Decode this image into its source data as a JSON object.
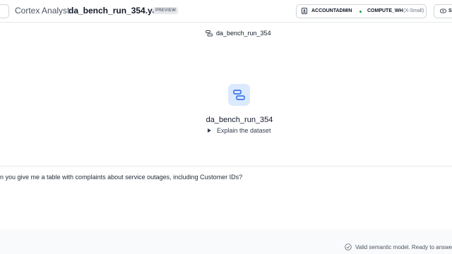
{
  "header": {
    "app_name": "Cortex Analyst",
    "file_name": "da_bench_run_354.yaml",
    "badge": "PREVIEW",
    "role": "ACCOUNTADMIN",
    "warehouse": "COMPUTE_WH",
    "warehouse_size": "(X-Small)",
    "share_label": "S"
  },
  "model_chip": {
    "label": "da_bench_run_354",
    "icon": "semantic-model-icon"
  },
  "center": {
    "icon": "semantic-model-icon",
    "title": "da_bench_run_354",
    "explain_label": "Explain the dataset"
  },
  "prompt": {
    "text": "n you give me a table with complaints about service outages, including Customer IDs?"
  },
  "footer": {
    "status_text": "Valid semantic model. Ready to answe",
    "status_icon": "check-circle-icon"
  },
  "colors": {
    "accent": "#2563eb",
    "accent_bg": "#dbeafe",
    "status_dot": "#16a34a"
  }
}
